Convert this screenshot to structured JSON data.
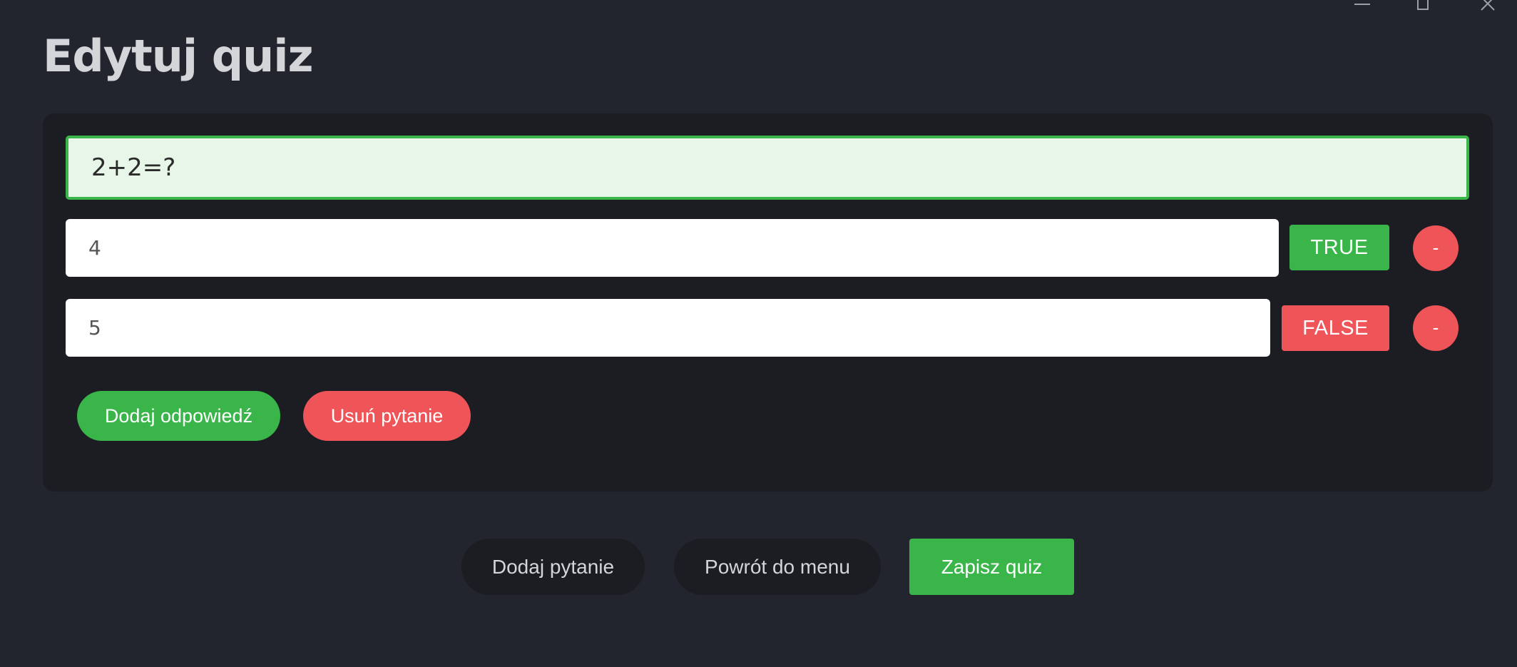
{
  "window": {
    "controls": [
      "minimize-icon",
      "maximize-icon",
      "close-icon"
    ]
  },
  "page": {
    "title": "Edytuj quiz"
  },
  "question": {
    "text": "2+2=?",
    "answers": [
      {
        "value": "4",
        "correct_label": "TRUE",
        "remove_label": "-"
      },
      {
        "value": "5",
        "correct_label": "FALSE",
        "remove_label": "-"
      }
    ],
    "add_answer_label": "Dodaj odpowiedź",
    "delete_question_label": "Usuń pytanie"
  },
  "footer": {
    "add_question_label": "Dodaj pytanie",
    "back_label": "Powrót do menu",
    "save_label": "Zapisz quiz"
  },
  "colors": {
    "background": "#22252e",
    "card": "#1b1d22",
    "accent_green": "#3ab54a",
    "accent_red": "#ef5458",
    "question_bg": "#e7f6e8"
  }
}
